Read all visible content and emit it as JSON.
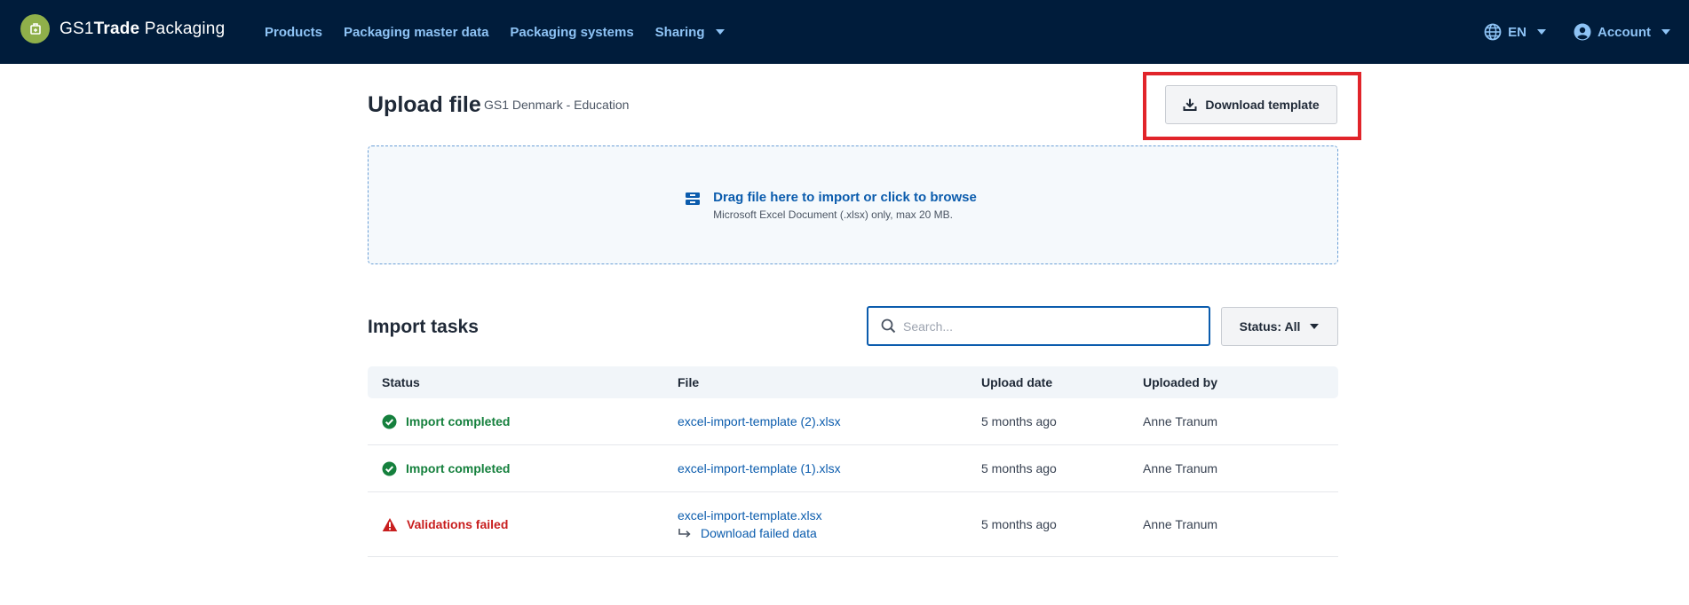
{
  "brand": {
    "name_prefix": "GS1",
    "name_bold": "Trade",
    "name_suffix": " Packaging"
  },
  "nav": {
    "items": [
      {
        "label": "Products"
      },
      {
        "label": "Packaging master data"
      },
      {
        "label": "Packaging systems"
      },
      {
        "label": "Sharing"
      }
    ],
    "language": "EN",
    "account": "Account"
  },
  "header": {
    "title": "Upload file",
    "subtitle": "GS1 Denmark - Education",
    "download_template_label": "Download template"
  },
  "dropzone": {
    "main": "Drag file here to import or click to browse",
    "sub": "Microsoft Excel Document (.xlsx) only, max 20 MB."
  },
  "import_tasks": {
    "title": "Import tasks",
    "search_placeholder": "Search...",
    "status_filter_label": "Status: All",
    "columns": {
      "status": "Status",
      "file": "File",
      "upload_date": "Upload date",
      "uploaded_by": "Uploaded by"
    },
    "rows": [
      {
        "status": "Import completed",
        "file": "excel-import-template (2).xlsx",
        "upload_date": "5 months ago",
        "uploaded_by": "Anne Tranum"
      },
      {
        "status": "Import completed",
        "file": "excel-import-template (1).xlsx",
        "upload_date": "5 months ago",
        "uploaded_by": "Anne Tranum"
      },
      {
        "status": "Validations failed",
        "file": "excel-import-template.xlsx",
        "sub_link": "Download failed data",
        "upload_date": "5 months ago",
        "uploaded_by": "Anne Tranum"
      }
    ]
  },
  "colors": {
    "topbar": "#001c3b",
    "nav_link": "#8ec3f5",
    "link": "#0b5cad",
    "success": "#15803d",
    "error": "#c81e1e",
    "highlight": "#e1242a",
    "logo": "#8fb04a"
  },
  "icons": [
    "gs1-logo-icon",
    "globe-icon",
    "user-circle-icon",
    "chevron-down-icon",
    "download-icon",
    "upload-tray-icon",
    "search-icon",
    "check-circle-icon",
    "warning-triangle-icon",
    "return-arrow-icon"
  ]
}
